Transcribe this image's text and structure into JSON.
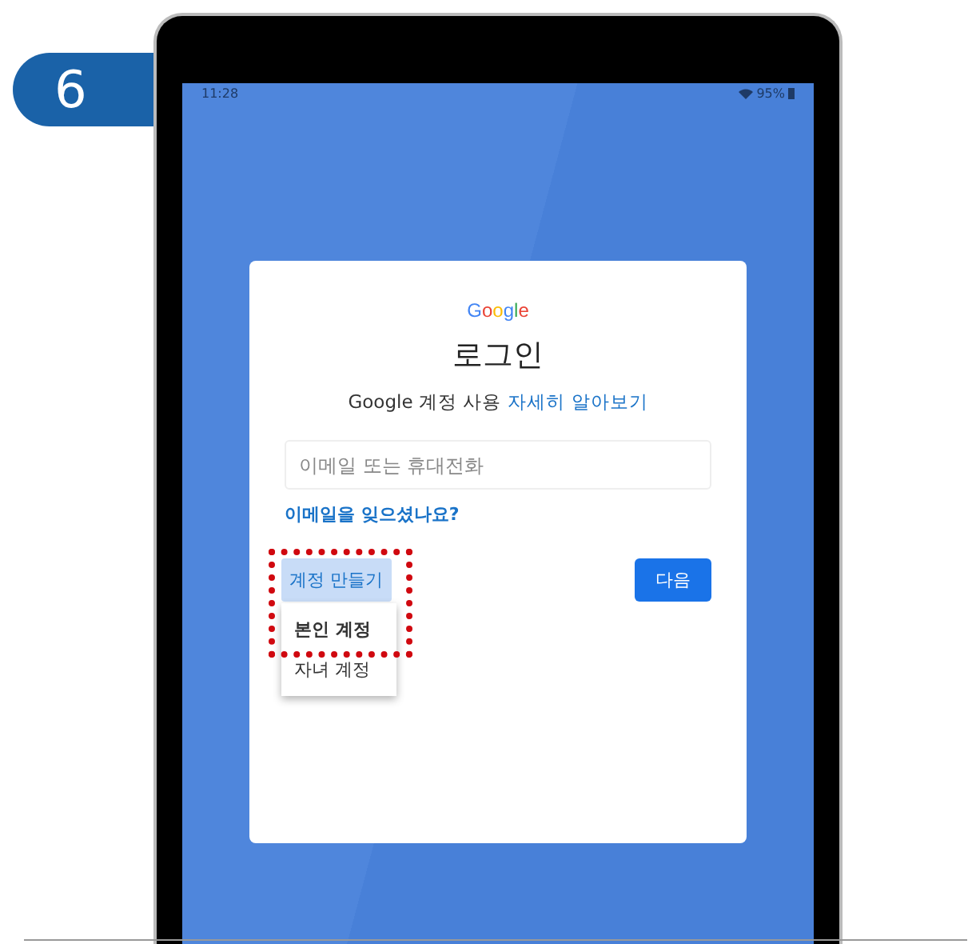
{
  "step_badge": "6",
  "status_bar": {
    "time": "11:28",
    "battery": "95%"
  },
  "login_card": {
    "logo": "Google",
    "title": "로그인",
    "subtitle": "Google 계정 사용",
    "learn_more_link": "자세히 알아보기",
    "email_field": {
      "placeholder": "이메일 또는 휴대전화"
    },
    "forgot_email_link": "이메일을 잊으셨나요?",
    "create_account_button": {
      "label": "계정 만들기",
      "expanded": true
    },
    "create_account_menu": [
      {
        "label": "본인 계정",
        "highlighted": true
      },
      {
        "label": "자녀 계정",
        "highlighted": false
      }
    ],
    "next_button": "다음"
  }
}
